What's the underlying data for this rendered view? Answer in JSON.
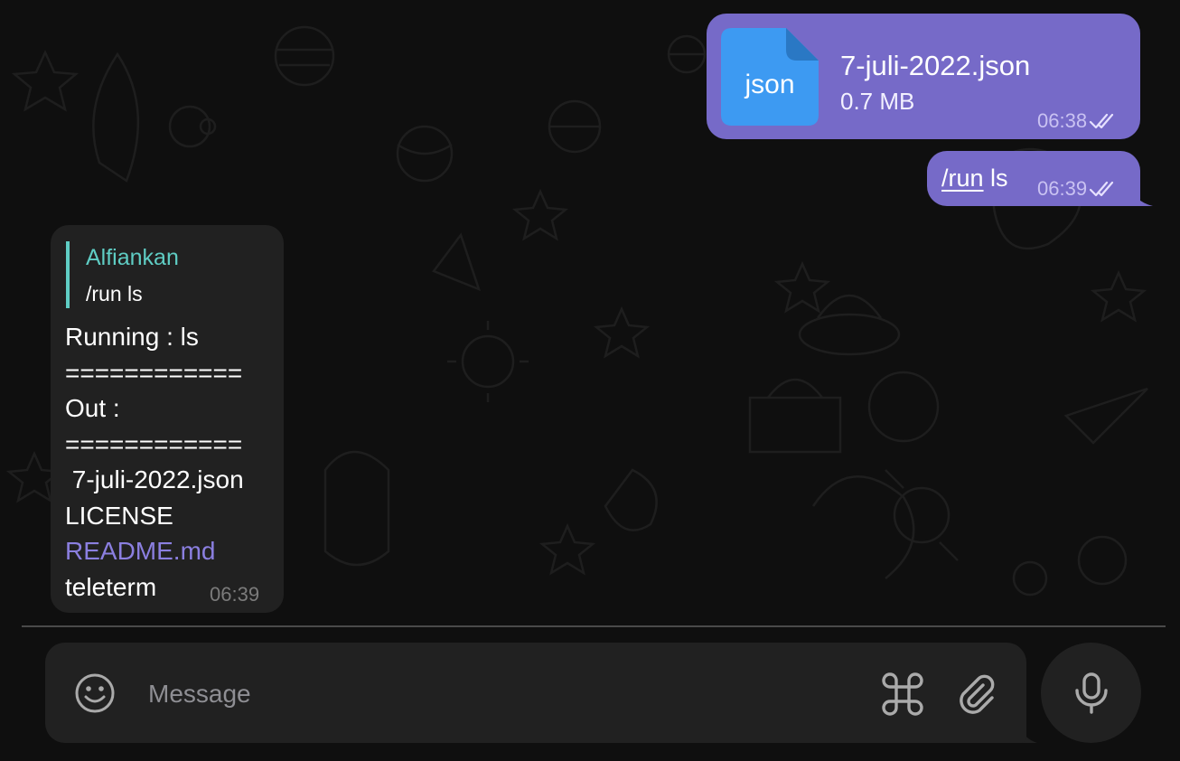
{
  "messages": {
    "outgoing_file": {
      "file_type": "json",
      "file_name": "7-juli-2022.json",
      "file_size": "0.7 MB",
      "time": "06:38"
    },
    "outgoing_command": {
      "command": "/run",
      "argument": " ls",
      "time": "06:39"
    },
    "incoming_reply": {
      "reply_sender": "Alfiankan",
      "reply_text": "/run ls",
      "lines": [
        "Running : ls",
        "============",
        "Out :",
        "============",
        " 7-juli-2022.json",
        "LICENSE",
        "README.md",
        "teleterm"
      ],
      "time": "06:39"
    }
  },
  "composer": {
    "placeholder": "Message"
  },
  "icons": {
    "emoji": "smile-icon",
    "commands": "command-icon",
    "attach": "paperclip-icon",
    "voice": "microphone-icon",
    "read": "double-check-icon"
  },
  "colors": {
    "outgoing_bubble": "#766ac8",
    "incoming_bubble": "#212121",
    "reply_accent": "#5fcdc4",
    "link": "#8b7fe0",
    "file_icon": "#3d9af2"
  }
}
